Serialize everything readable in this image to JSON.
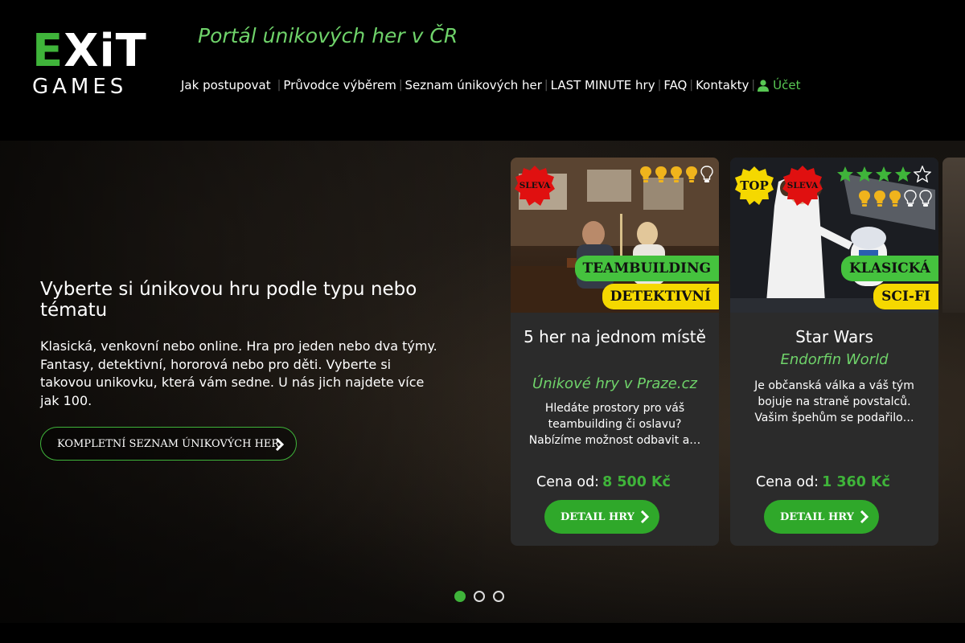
{
  "logo": {
    "exit_part1": "E",
    "exit_part2": "XiT",
    "games": "GAMES"
  },
  "header": {
    "tagline": "Portál únikových her v ČR",
    "nav": [
      {
        "label": "Jak postupovat"
      },
      {
        "label": "Průvodce výběrem"
      },
      {
        "label": "Seznam únikových her"
      },
      {
        "label": "LAST MINUTE hry"
      },
      {
        "label": "FAQ"
      },
      {
        "label": "Kontakty"
      }
    ],
    "account_label": "Účet",
    "separator": "|"
  },
  "hero": {
    "title": "Vyberte si únikovou hru podle typu nebo tématu",
    "text": "Klasická, venkovní nebo online. Hra pro jeden nebo dva týmy. Fantasy, detektivní, hororová nebo pro děti. Vyberte si takovou unikovku, která vám sedne. U nás jich najdete více jak 100.",
    "button_label": "KOMPLETNÍ SEZNAM ÚNIKOVÝCH HER"
  },
  "cards": [
    {
      "title": "5 her na jednom místě",
      "subtitle": "Únikové hry v Praze.cz",
      "description": "Hledáte prostory pro váš teambuilding či oslavu? Nabízíme možnost odbavit a…",
      "price_label": "Cena od:",
      "price_value": "8 500 Kč",
      "detail_label": "DETAIL HRY",
      "badge_sleva": "SLEVA",
      "tags": [
        "TEAMBUILDING",
        "DETEKTIVNÍ"
      ],
      "difficulty_lit": 4,
      "difficulty_max": 5
    },
    {
      "title": "Star Wars",
      "subtitle": "Endorfin World",
      "description": "Je občanská válka a váš tým bojuje na straně povstalců. Vašim špehům se podařilo…",
      "price_label": "Cena od:",
      "price_value": "1 360 Kč",
      "detail_label": "DETAIL HRY",
      "badge_top": "TOP",
      "badge_sleva": "SLEVA",
      "tags": [
        "KLASICKÁ",
        "SCI-FI"
      ],
      "rating": 4,
      "rating_max": 5,
      "difficulty_lit": 3,
      "difficulty_max": 5
    }
  ],
  "carousel": {
    "pages": 3,
    "active": 1
  },
  "colors": {
    "accent": "#3fb43a",
    "tagline": "#6fd36a",
    "badge_red": "#e01010",
    "badge_yellow": "#f5d800",
    "tag_green": "#45c23e",
    "tag_yellow": "#f5d800"
  },
  "icons": [
    "user-icon",
    "chevron-right-icon",
    "lightbulb-icon",
    "star-icon"
  ]
}
